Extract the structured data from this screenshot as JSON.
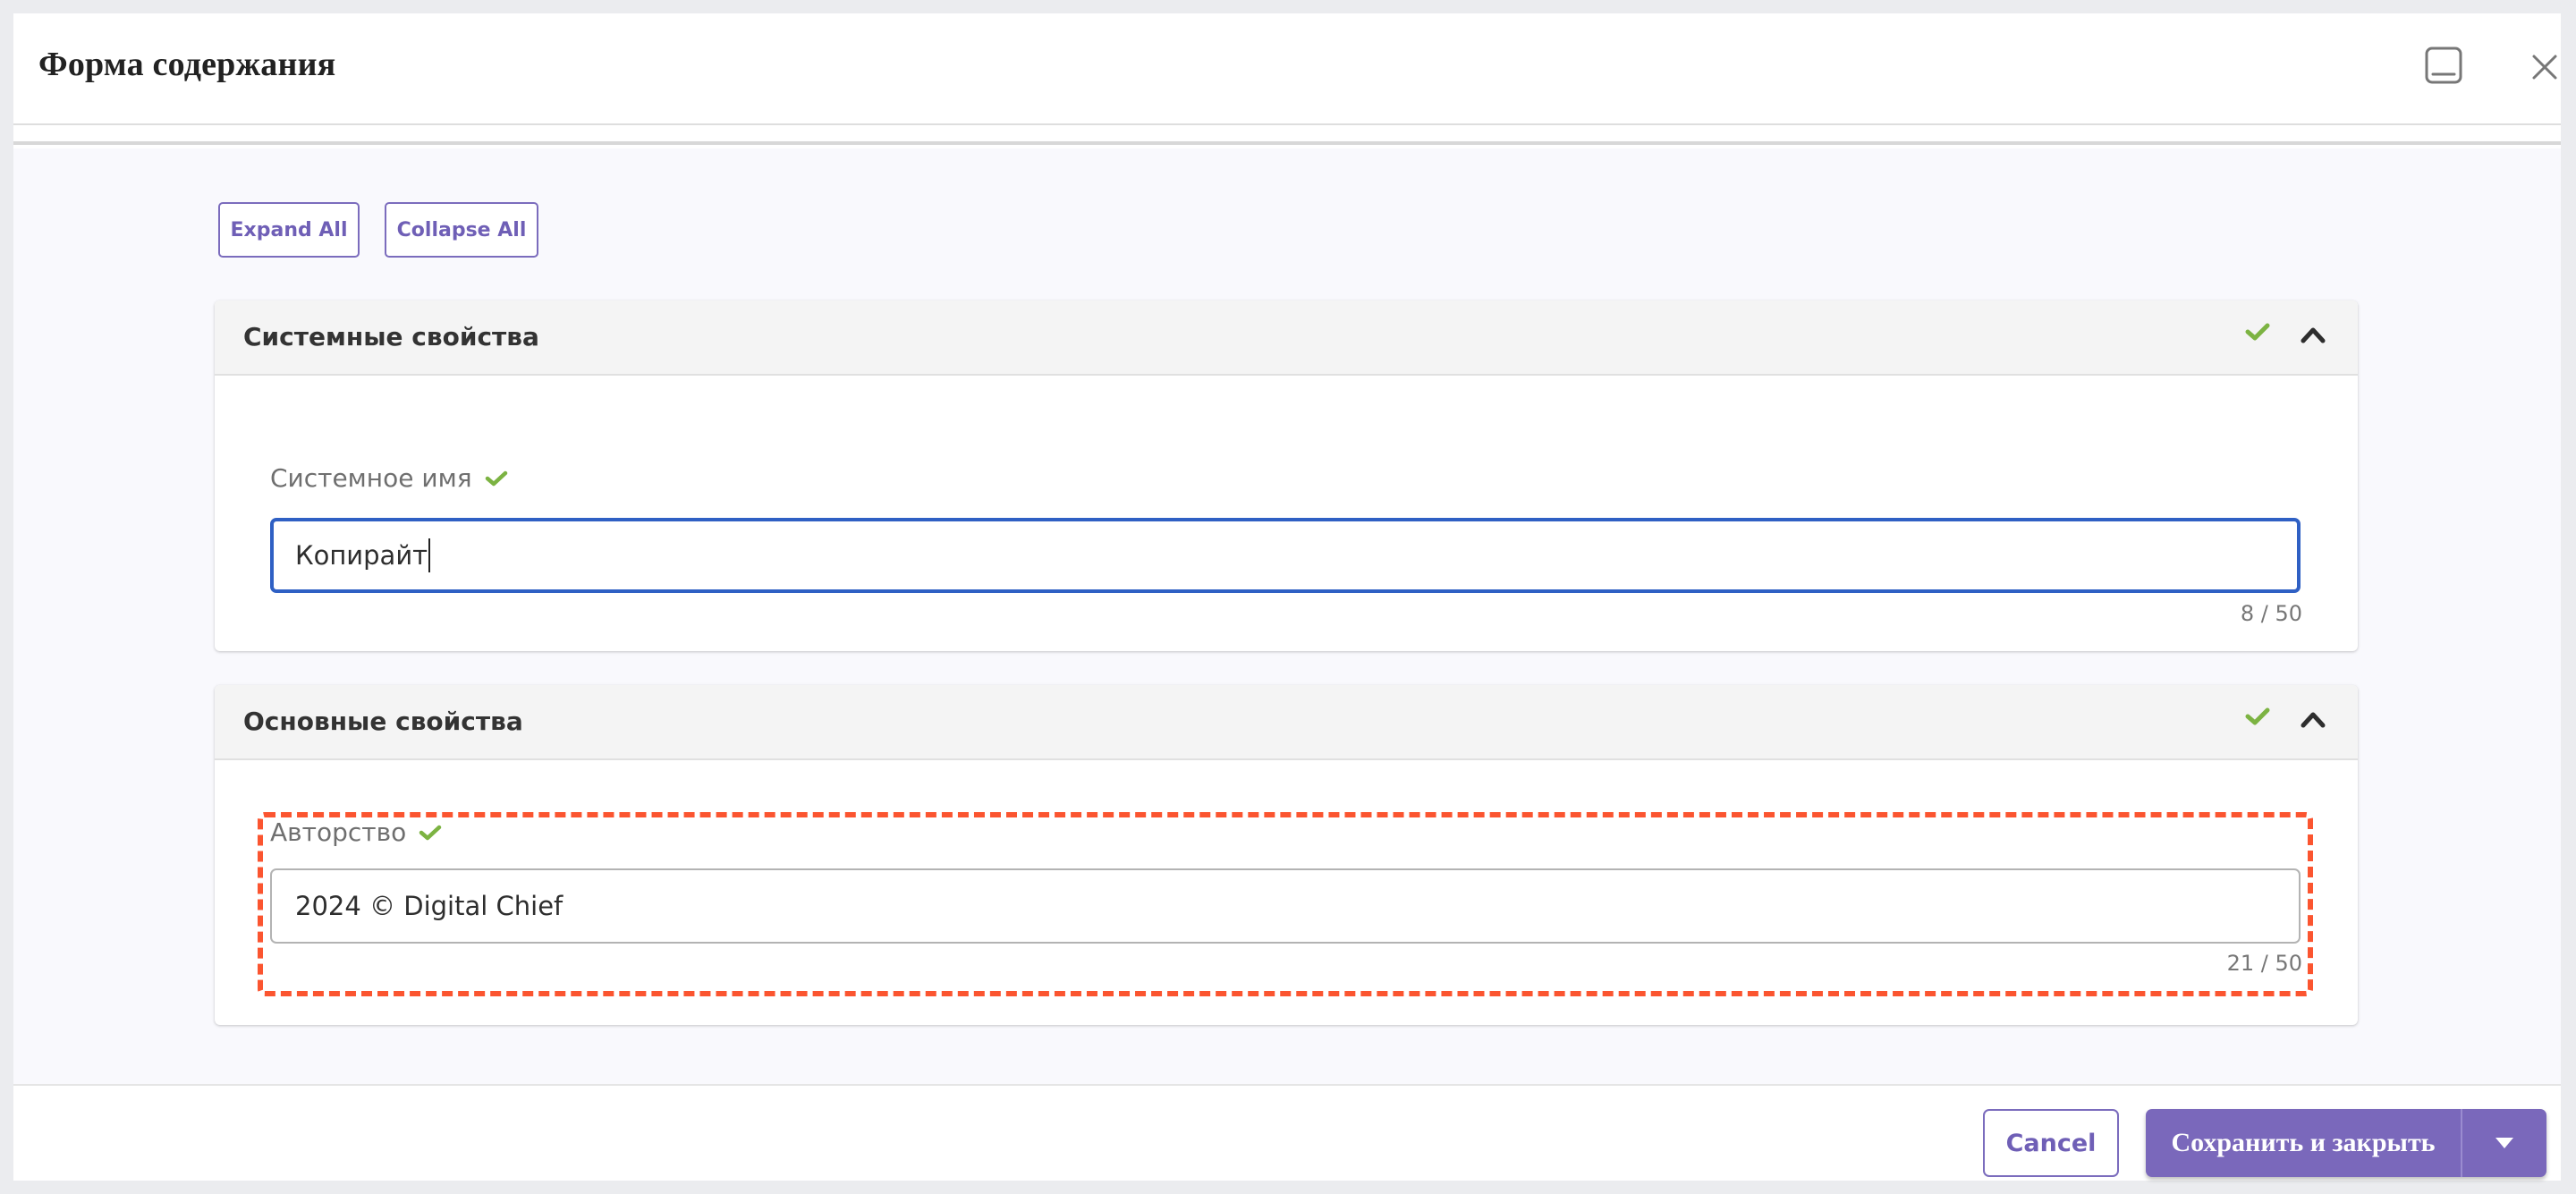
{
  "modal": {
    "title": "Форма содержания",
    "icons": {
      "minimize": "minimize-panel-icon",
      "close": "close-icon"
    }
  },
  "toolbar": {
    "expand_all_label": "Expand All",
    "collapse_all_label": "Collapse All"
  },
  "sections": [
    {
      "title": "Системные свойства",
      "valid": true,
      "expanded": true,
      "fields": [
        {
          "label": "Системное имя",
          "valid": true,
          "value": "Копирайт",
          "focused": true,
          "counter": "8 / 50"
        }
      ]
    },
    {
      "title": "Основные свойства",
      "valid": true,
      "expanded": true,
      "fields": [
        {
          "label": "Авторство",
          "valid": true,
          "value": "2024 © Digital Chief",
          "focused": false,
          "highlighted": true,
          "counter": "21 / 50"
        }
      ]
    }
  ],
  "footer": {
    "cancel_label": "Cancel",
    "save_close_label": "Сохранить и закрыть"
  },
  "colors": {
    "accent": "#7a68bb",
    "valid_check": "#7cb342",
    "focus_border": "#2f60c4",
    "highlight_dashed": "#fb5530"
  }
}
